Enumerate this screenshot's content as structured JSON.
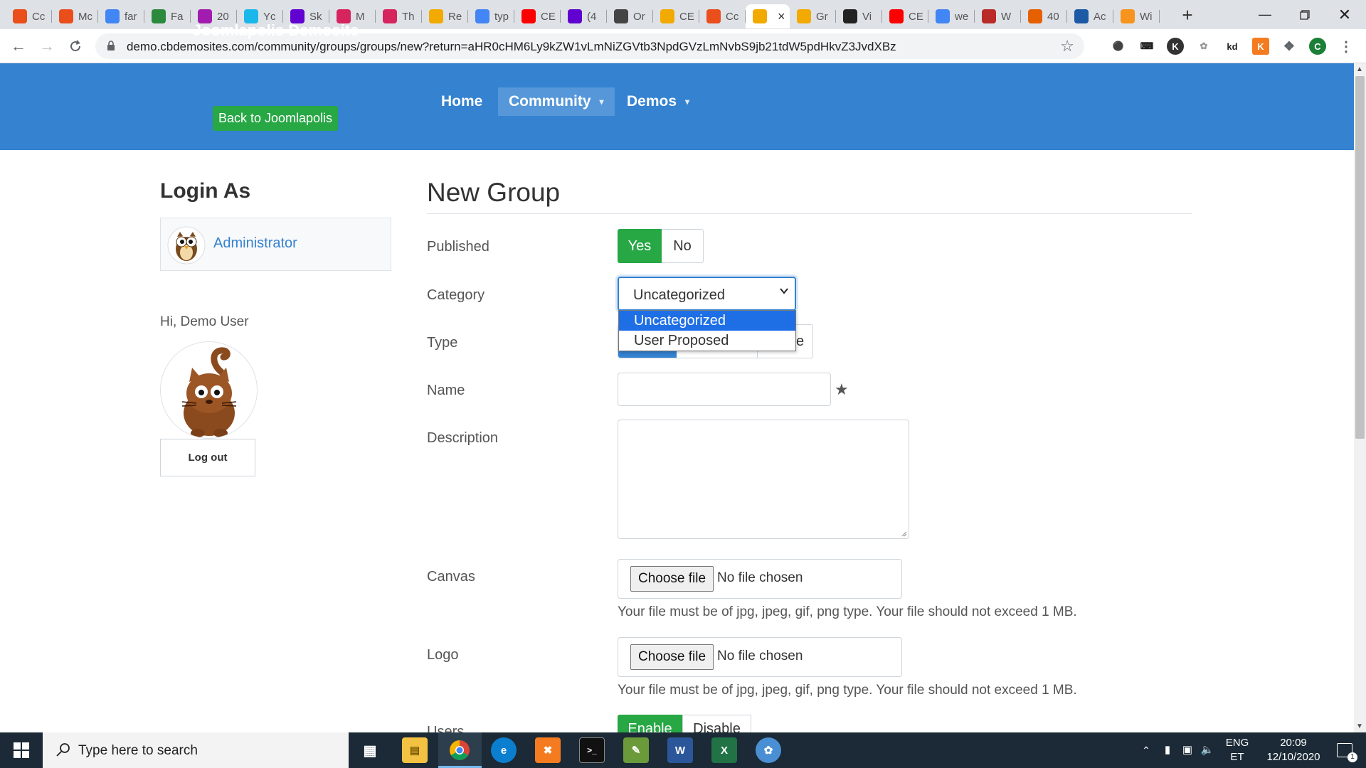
{
  "browser": {
    "tabs": [
      {
        "label": "Cc",
        "icon": "joomla-icon",
        "color": "#e94e1b"
      },
      {
        "label": "Mc",
        "icon": "joomla-icon",
        "color": "#e94e1b"
      },
      {
        "label": "far",
        "icon": "google-icon",
        "color": "#4285f4"
      },
      {
        "label": "Fa",
        "icon": "globe-icon",
        "color": "#2b8a3e"
      },
      {
        "label": "20",
        "icon": "circle-icon",
        "color": "#a21caf"
      },
      {
        "label": "Yc",
        "icon": "vimeo-icon",
        "color": "#1ab7ea"
      },
      {
        "label": "Sk",
        "icon": "yahoo-icon",
        "color": "#6001d2"
      },
      {
        "label": "M",
        "icon": "m-icon",
        "color": "#d6245e"
      },
      {
        "label": "Th",
        "icon": "m-icon",
        "color": "#d6245e"
      },
      {
        "label": "Re",
        "icon": "bubble-icon",
        "color": "#f2a900"
      },
      {
        "label": "typ",
        "icon": "google-icon",
        "color": "#4285f4"
      },
      {
        "label": "CE",
        "icon": "youtube-icon",
        "color": "#ff0000"
      },
      {
        "label": "(4",
        "icon": "mail-icon",
        "color": "#6001d2"
      },
      {
        "label": "Or",
        "icon": "globe-icon",
        "color": "#444444"
      },
      {
        "label": "CE",
        "icon": "bubble-icon",
        "color": "#f2a900"
      },
      {
        "label": "Cc",
        "icon": "joomla-icon",
        "color": "#e94e1b"
      },
      {
        "label": "",
        "icon": "bubble-icon",
        "color": "#f2a900",
        "active": true
      },
      {
        "label": "Gr",
        "icon": "bubble-icon",
        "color": "#f2a900"
      },
      {
        "label": "Vi",
        "icon": "xd-icon",
        "color": "#222222"
      },
      {
        "label": "CE",
        "icon": "youtube-icon",
        "color": "#ff0000"
      },
      {
        "label": "we",
        "icon": "google-icon",
        "color": "#4285f4"
      },
      {
        "label": "W",
        "icon": "quora-icon",
        "color": "#b92b27"
      },
      {
        "label": "40",
        "icon": "firefox-icon",
        "color": "#e66000"
      },
      {
        "label": "Ac",
        "icon": "ps-icon",
        "color": "#1c5aa6"
      },
      {
        "label": "Wi",
        "icon": "w-icon",
        "color": "#f7941d"
      }
    ],
    "url": "demo.cbdemosites.com/community/groups/groups/new?return=aHR0cHM6Ly9kZW1vLmNiZGVtb3NpdGVzLmNvbS9jb21tdW5pdHkvZ3JvdXBz",
    "profile_initial": "C",
    "ext_kd": "kd"
  },
  "site": {
    "brand": "Joomlapolis Demosite",
    "back_button": "Back to Joomlapolis",
    "nav": [
      {
        "label": "Home"
      },
      {
        "label": "Community",
        "caret": "▾"
      },
      {
        "label": "Demos",
        "caret": "▾"
      }
    ]
  },
  "sidebar": {
    "title": "Login As",
    "admin_link": "Administrator",
    "greeting": "Hi, Demo User",
    "logout": "Log out"
  },
  "form": {
    "title": "New Group",
    "published": {
      "label": "Published",
      "yes": "Yes",
      "no": "No"
    },
    "category": {
      "label": "Category",
      "selected": "Uncategorized",
      "options": [
        "Uncategorized",
        "User Proposed"
      ]
    },
    "type": {
      "label": "Type",
      "tail_text": "e"
    },
    "name": {
      "label": "Name",
      "value": ""
    },
    "description": {
      "label": "Description",
      "value": ""
    },
    "canvas": {
      "label": "Canvas",
      "button": "Choose file",
      "status": "No file chosen",
      "help": "Your file must be of jpg, jpeg, gif, png type. Your file should not exceed 1 MB."
    },
    "logo": {
      "label": "Logo",
      "button": "Choose file",
      "status": "No file chosen",
      "help": "Your file must be of jpg, jpeg, gif, png type. Your file should not exceed 1 MB."
    },
    "users": {
      "label": "Users",
      "enable": "Enable",
      "disable": "Disable"
    }
  },
  "taskbar": {
    "search_placeholder": "Type here to search",
    "lang": "ENG",
    "lang_sub": "ET",
    "time": "20:09",
    "date": "12/10/2020",
    "notification_count": "1"
  },
  "colors": {
    "header_blue": "#3482d0",
    "green": "#28a745",
    "dropdown_highlight": "#1e6fe6"
  }
}
